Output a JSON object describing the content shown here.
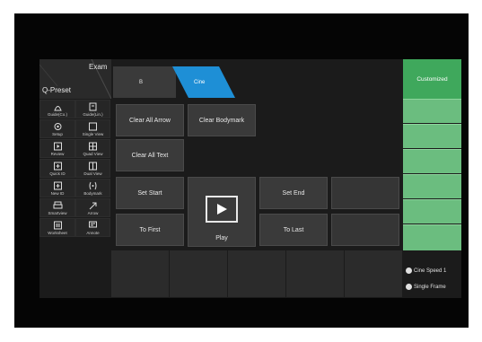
{
  "qpreset": {
    "title": "Q-Preset",
    "exam": "Exam"
  },
  "tabs": [
    {
      "label": "B"
    },
    {
      "label": "Cine"
    }
  ],
  "sidebar": {
    "items": [
      {
        "label": "Guide(Co.)",
        "icon": "convex-probe-icon"
      },
      {
        "label": "Guide(Lin.)",
        "icon": "linear-probe-icon"
      },
      {
        "label": "Setup",
        "icon": "gear-icon"
      },
      {
        "label": "Single View",
        "icon": "single-view-icon"
      },
      {
        "label": "Review",
        "icon": "review-icon"
      },
      {
        "label": "Quad View",
        "icon": "quad-view-icon"
      },
      {
        "label": "Quick ID",
        "icon": "quick-id-icon"
      },
      {
        "label": "Dual View",
        "icon": "dual-view-icon"
      },
      {
        "label": "New ID",
        "icon": "new-id-icon"
      },
      {
        "label": "Bodymark",
        "icon": "bodymark-icon"
      },
      {
        "label": "Smartview",
        "icon": "printer-icon"
      },
      {
        "label": "Arrow",
        "icon": "arrow-icon"
      },
      {
        "label": "Worksheet",
        "icon": "worksheet-icon"
      },
      {
        "label": "Annote",
        "icon": "annotate-icon"
      }
    ]
  },
  "buttons": {
    "clear_all_arrow": "Clear All Arrow",
    "clear_bodymark": "Clear Bodymark",
    "clear_all_text": "Clear All Text",
    "set_start": "Set Start",
    "set_end": "Set End",
    "play": "Play",
    "to_first": "To First",
    "to_last": "To Last"
  },
  "right_panel": {
    "customized": "Customized"
  },
  "status": {
    "cine_speed": "Cine Speed 1",
    "single_frame": "Single Frame"
  },
  "colors": {
    "accent": "#1e8fd6",
    "green": "#6bbd7f",
    "green_header": "#3fa85c"
  }
}
